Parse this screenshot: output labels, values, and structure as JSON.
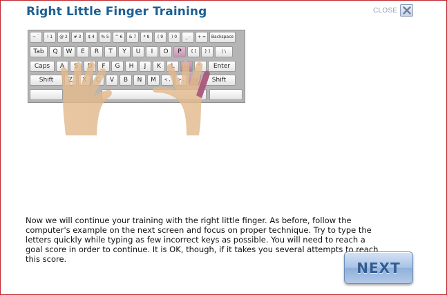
{
  "title": "Right Little Finger Training",
  "close_label": "CLOSE",
  "keyboard": {
    "rows": [
      [
        "~ `",
        "! 1",
        "@ 2",
        "# 3",
        "$ 4",
        "% 5",
        "^ 6",
        "& 7",
        "* 8",
        "( 9",
        ") 0",
        "_ -",
        "+ =",
        "Backspace"
      ],
      [
        "Tab",
        "Q",
        "W",
        "E",
        "R",
        "T",
        "Y",
        "U",
        "I",
        "O",
        "P",
        "{ [",
        "} ]",
        "| \\"
      ],
      [
        "Caps",
        "A",
        "S",
        "D",
        "F",
        "G",
        "H",
        "J",
        "K",
        "L",
        ": ;",
        "\" '",
        "Enter"
      ],
      [
        "Shift",
        "Z",
        "X",
        "C",
        "V",
        "B",
        "N",
        "M",
        "< ,",
        "> .",
        "? /",
        "Shift"
      ],
      [
        "",
        "",
        ""
      ]
    ],
    "highlighted_keys": [
      "P",
      ": ;",
      "? /"
    ]
  },
  "instructions": "Now we will continue your training with the right little finger. As before, follow the computer's example on the next screen and focus on proper technique. Try to type the letters quickly while typing as few incorrect keys as possible. You will need to reach a goal score in order to continue. It is OK, though, if it takes you several attempts to reach this score.",
  "next_label": "NEXT",
  "colors": {
    "title": "#1d5f92",
    "frame_border": "#c0262c",
    "highlight_key": "#c495b3",
    "skin": "#e2b98c"
  }
}
